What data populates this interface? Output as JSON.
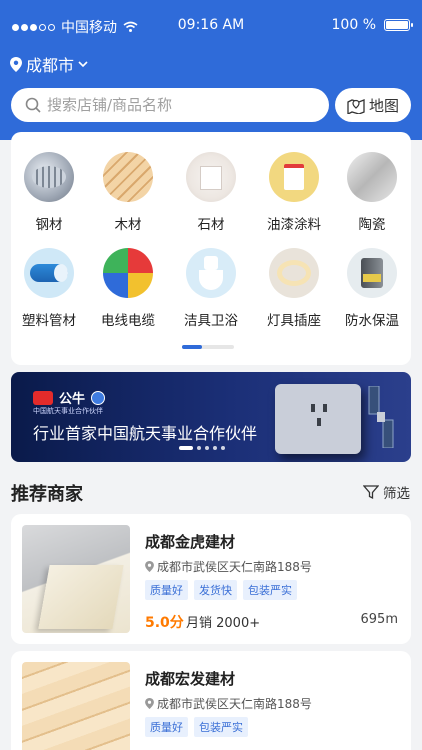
{
  "status_bar": {
    "carrier": "中国移动",
    "time": "09:16 AM",
    "battery": "100 %"
  },
  "location": {
    "city": "成都市"
  },
  "search": {
    "placeholder": "搜索店铺/商品名称",
    "map_label": "地图"
  },
  "categories": [
    {
      "label": "钢材",
      "icon": "steel-icon"
    },
    {
      "label": "木材",
      "icon": "wood-icon"
    },
    {
      "label": "石材",
      "icon": "stone-icon"
    },
    {
      "label": "油漆涂料",
      "icon": "paint-icon"
    },
    {
      "label": "陶瓷",
      "icon": "ceramic-icon"
    },
    {
      "label": "塑料管材",
      "icon": "pipe-icon"
    },
    {
      "label": "电线电缆",
      "icon": "cable-icon"
    },
    {
      "label": "洁具卫浴",
      "icon": "toilet-icon"
    },
    {
      "label": "灯具插座",
      "icon": "lamp-icon"
    },
    {
      "label": "防水保温",
      "icon": "waterproof-icon"
    }
  ],
  "banner": {
    "brand": "公牛",
    "sub": "中国航天事业合作伙伴",
    "headline": "行业首家中国航天事业合作伙伴"
  },
  "section": {
    "title": "推荐商家",
    "filter_label": "筛选"
  },
  "shops": [
    {
      "name": "成都金虎建材",
      "address": "成都市武侯区天仁南路188号",
      "tags": [
        "质量好",
        "发货快",
        "包装严实"
      ],
      "score": "5.0分",
      "sales": "月销 2000+",
      "distance": "695m"
    },
    {
      "name": "成都宏发建材",
      "address": "成都市武侯区天仁南路188号",
      "tags": [
        "质量好",
        "包装严实"
      ]
    }
  ],
  "colors": {
    "primary": "#2f6bd9",
    "score": "#ff7a00",
    "tag_text": "#3a6fd6",
    "tag_bg": "#e8f0fd"
  }
}
